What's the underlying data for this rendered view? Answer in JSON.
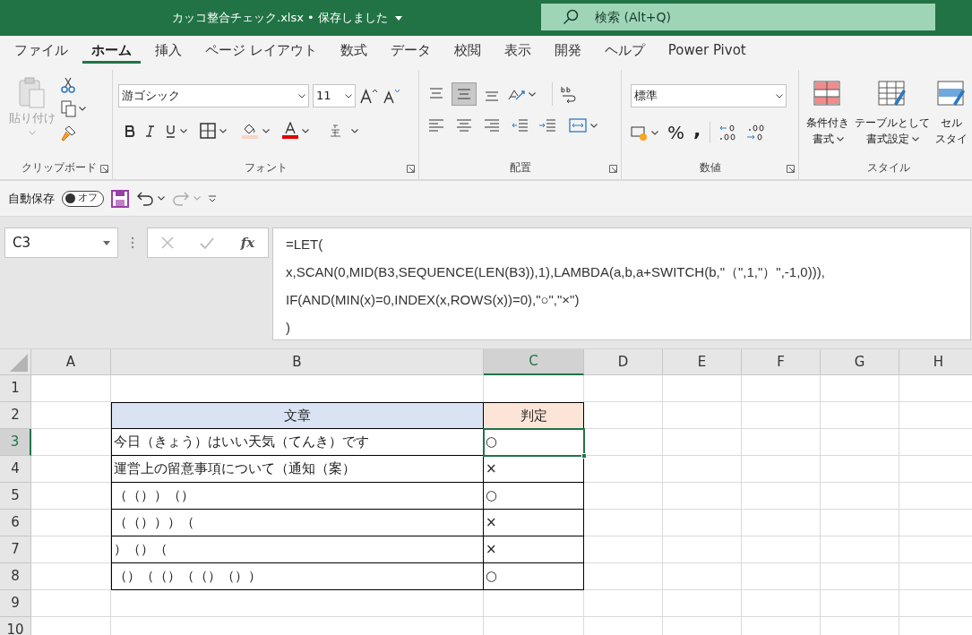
{
  "title_bar": {
    "file_title": "カッコ整合チェック.xlsx • 保存しました",
    "search_placeholder": "検索 (Alt+Q)"
  },
  "menu_tabs": [
    {
      "label": "ファイル",
      "selected": false
    },
    {
      "label": "ホーム",
      "selected": true
    },
    {
      "label": "挿入",
      "selected": false
    },
    {
      "label": "ページ レイアウト",
      "selected": false
    },
    {
      "label": "数式",
      "selected": false
    },
    {
      "label": "データ",
      "selected": false
    },
    {
      "label": "校閲",
      "selected": false
    },
    {
      "label": "表示",
      "selected": false
    },
    {
      "label": "開発",
      "selected": false
    },
    {
      "label": "ヘルプ",
      "selected": false
    },
    {
      "label": "Power Pivot",
      "selected": false
    }
  ],
  "ribbon": {
    "clipboard": {
      "paste_label": "貼り付け",
      "group_label": "クリップボード"
    },
    "font": {
      "font_name": "游ゴシック",
      "font_size": "11",
      "group_label": "フォント"
    },
    "alignment": {
      "group_label": "配置"
    },
    "number": {
      "format": "標準",
      "percent": "%",
      "comma": ",",
      "group_label": "数値"
    },
    "styles": {
      "buttons": [
        {
          "line1": "条件付き",
          "line2": "書式"
        },
        {
          "line1": "テーブルとして",
          "line2": "書式設定"
        },
        {
          "line1": "セル",
          "line2": "スタイ"
        }
      ],
      "group_label": "スタイル"
    }
  },
  "quick_access": {
    "autosave_label": "自動保存",
    "autosave_state": "オフ",
    "autosave_on": false
  },
  "formula_bar": {
    "name_box": "C3",
    "function_label": "fx",
    "lines": [
      "=LET(",
      "x,SCAN(0,MID(B3,SEQUENCE(LEN(B3)),1),LAMBDA(a,b,a+SWITCH(b,\"（\",1,\"）\",-1,0))),",
      "IF(AND(MIN(x)=0,INDEX(x,ROWS(x))=0),\"○\",\"×\")",
      ")"
    ]
  },
  "sheet": {
    "columns": [
      {
        "label": "A",
        "selected": false
      },
      {
        "label": "B",
        "selected": false
      },
      {
        "label": "C",
        "selected": true
      },
      {
        "label": "D",
        "selected": false
      },
      {
        "label": "E",
        "selected": false
      },
      {
        "label": "F",
        "selected": false
      },
      {
        "label": "G",
        "selected": false
      },
      {
        "label": "H",
        "selected": false
      }
    ],
    "row_headers": [
      {
        "label": "1",
        "selected": false
      },
      {
        "label": "2",
        "selected": false
      },
      {
        "label": "3",
        "selected": true
      },
      {
        "label": "4",
        "selected": false
      },
      {
        "label": "5",
        "selected": false
      },
      {
        "label": "6",
        "selected": false
      },
      {
        "label": "7",
        "selected": false
      },
      {
        "label": "8",
        "selected": false
      },
      {
        "label": "9",
        "selected": false
      },
      {
        "label": "10",
        "selected": false
      }
    ],
    "table_headers": [
      "文章",
      "判定"
    ],
    "table_rows": [
      {
        "text": "今日（きょう）はいい天気（てんき）です",
        "result": "○",
        "selected": true
      },
      {
        "text": "運営上の留意事項について（通知（案）",
        "result": "×",
        "selected": false
      },
      {
        "text": "（（））（）",
        "result": "○",
        "selected": false
      },
      {
        "text": "（（）））（",
        "result": "×",
        "selected": false
      },
      {
        "text": "）（）（",
        "result": "×",
        "selected": false
      },
      {
        "text": "（）（（）（（）（））",
        "result": "○",
        "selected": false
      }
    ]
  }
}
